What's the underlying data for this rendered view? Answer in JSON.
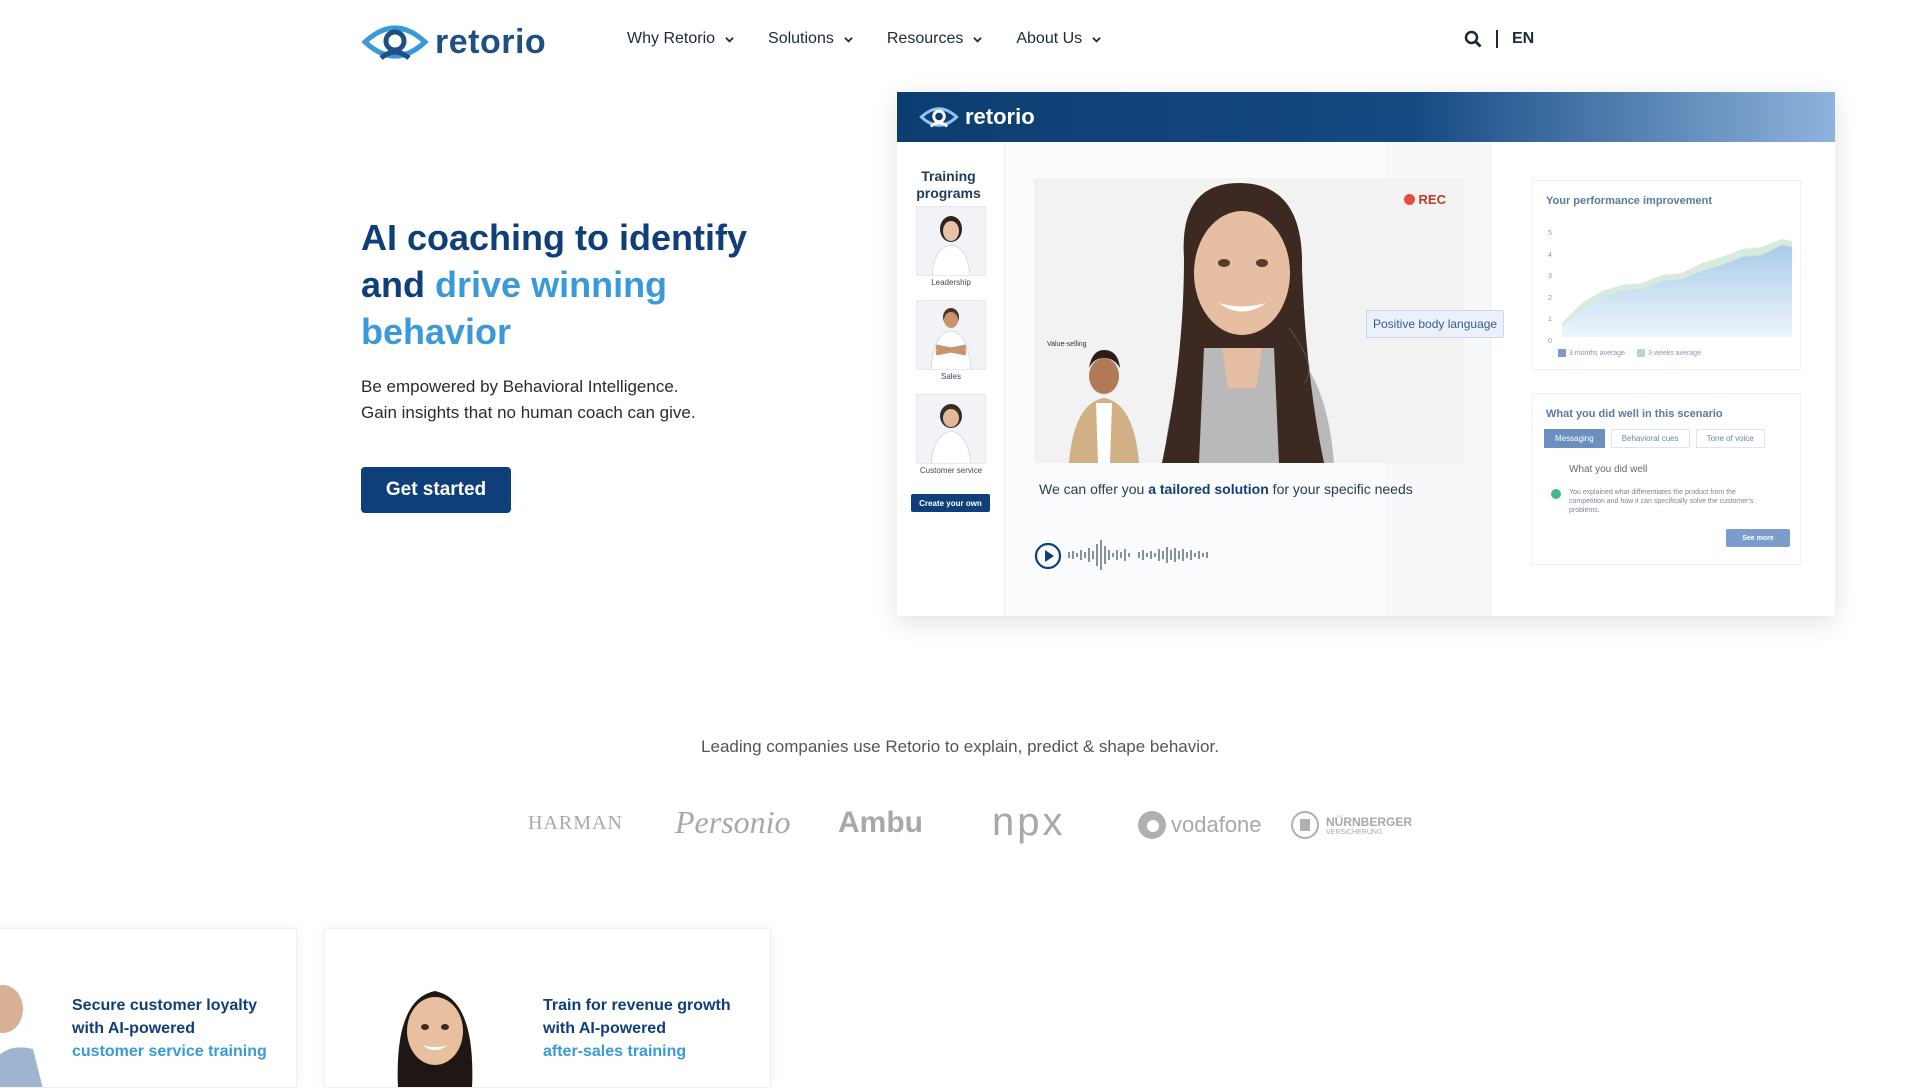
{
  "brand": {
    "name": "retorio"
  },
  "nav": {
    "items": [
      {
        "label": "Why Retorio"
      },
      {
        "label": "Solutions"
      },
      {
        "label": "Resources"
      },
      {
        "label": "About Us"
      }
    ],
    "lang": "EN"
  },
  "hero": {
    "title_line1": "AI coaching to identify",
    "title_and": "and",
    "title_accent": "drive winning behavior",
    "sub1": "Be empowered by Behavioral Intelligence.",
    "sub2": "Gain insights that no human coach can give.",
    "cta": "Get started"
  },
  "mock": {
    "logo": "retorio",
    "sidebar_title": "Training programs",
    "programs": [
      {
        "label": "Leadership"
      },
      {
        "label": "Sales"
      },
      {
        "label": "Customer service"
      }
    ],
    "create_btn": "Create your own",
    "rec": "REC",
    "tag": "Positive body language",
    "value_selling": "Value-selling",
    "caption_pre": "We can  offer you ",
    "caption_bold": "a tailored solution",
    "caption_post": " for your specific needs",
    "perf_title": "Your performance improvement",
    "perf_y_ticks": [
      "5",
      "4",
      "3",
      "2",
      "1",
      "0"
    ],
    "perf_legend": [
      "3 months average",
      "3 weeks average"
    ],
    "well_title": "What you did well in this scenario",
    "well_tabs": [
      "Messaging",
      "Behavioral cues",
      "Tone of voice"
    ],
    "well_sub": "What you did well",
    "well_text": "You explained what differentiates the product from the competition and how it can specifically solve the customer's problems.",
    "see_more": "See more"
  },
  "logos": {
    "leading": "Leading companies use Retorio to explain, predict & shape behavior.",
    "brands": [
      "HARMAN",
      "Personio",
      "Ambu",
      "npx",
      "vodafone",
      "NÜRNBERGER"
    ],
    "nurnberger_sub": "VERSICHERUNG"
  },
  "cards": [
    {
      "title1": "Secure customer loyalty",
      "title2": "with AI-powered",
      "accent": "customer service training"
    },
    {
      "title1": "Train for revenue growth",
      "title2": "with AI-powered",
      "accent": "after-sales training"
    }
  ],
  "colors": {
    "navy": "#0e3f7a",
    "accent": "#3a9ad9",
    "rec": "#e74c3c"
  }
}
